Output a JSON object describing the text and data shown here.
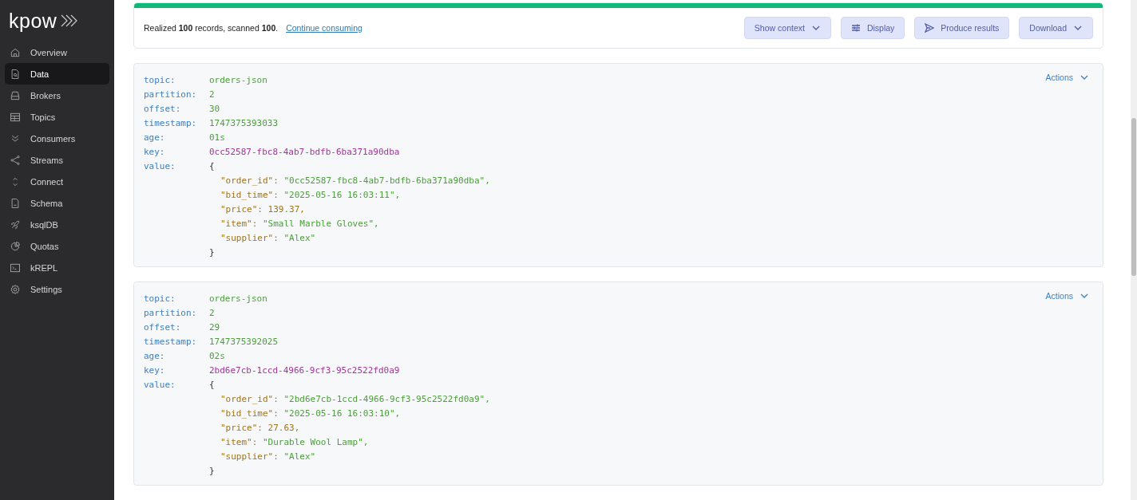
{
  "sidebar": {
    "logo": "kpow",
    "items": [
      {
        "label": "Overview",
        "selected": false
      },
      {
        "label": "Data",
        "selected": true
      },
      {
        "label": "Brokers",
        "selected": false
      },
      {
        "label": "Topics",
        "selected": false
      },
      {
        "label": "Consumers",
        "selected": false
      },
      {
        "label": "Streams",
        "selected": false
      },
      {
        "label": "Connect",
        "selected": false
      },
      {
        "label": "Schema",
        "selected": false
      },
      {
        "label": "ksqlDB",
        "selected": false
      },
      {
        "label": "Quotas",
        "selected": false
      },
      {
        "label": "kREPL",
        "selected": false
      },
      {
        "label": "Settings",
        "selected": false
      }
    ]
  },
  "progress": {
    "level": 1
  },
  "summary": {
    "text": "Realized **100** records, scanned **100**.",
    "link": "Continue consuming"
  },
  "toolbar": [
    {
      "label": "Show context",
      "kind": "dropdown"
    },
    {
      "label": "Display",
      "kind": "sliders"
    },
    {
      "label": "Produce results",
      "kind": "send"
    },
    {
      "label": "Download",
      "kind": "dropdown"
    }
  ],
  "records": [
    {
      "actions": "Actions",
      "fields": [
        {
          "label": "topic:",
          "value": "orders-json",
          "kind": "plain"
        },
        {
          "label": "partition:",
          "value": "2",
          "kind": "plain"
        },
        {
          "label": "offset:",
          "value": "30",
          "kind": "plain"
        },
        {
          "label": "timestamp:",
          "value": "1747375393033",
          "kind": "plain"
        },
        {
          "label": "age:",
          "value": "01s",
          "kind": "plain"
        },
        {
          "label": "key:",
          "value": "0cc52587-fbc8-4ab7-bdfb-6ba371a90dba",
          "kind": "key"
        }
      ],
      "value_label": "value:",
      "open": "{",
      "close": "}",
      "lines": [
        {
          "key": "\"order_id\":",
          "value": "\"0cc52587-fbc8-4ab7-bdfb-6ba371a90dba\",",
          "kind": "string"
        },
        {
          "key": "\"bid_time\":",
          "value": "\"2025-05-16 16:03:11\",",
          "kind": "string"
        },
        {
          "key": "\"price\":",
          "value": "139.37,",
          "kind": "number"
        },
        {
          "key": "\"item\":",
          "value": "\"Small Marble Gloves\",",
          "kind": "string"
        },
        {
          "key": "\"supplier\":",
          "value": "\"Alex\"",
          "kind": "string"
        }
      ]
    },
    {
      "actions": "Actions",
      "fields": [
        {
          "label": "topic:",
          "value": "orders-json",
          "kind": "plain"
        },
        {
          "label": "partition:",
          "value": "2",
          "kind": "plain"
        },
        {
          "label": "offset:",
          "value": "29",
          "kind": "plain"
        },
        {
          "label": "timestamp:",
          "value": "1747375392025",
          "kind": "plain"
        },
        {
          "label": "age:",
          "value": "02s",
          "kind": "plain"
        },
        {
          "label": "key:",
          "value": "2bd6e7cb-1ccd-4966-9cf3-95c2522fd0a9",
          "kind": "key"
        }
      ],
      "value_label": "value:",
      "open": "{",
      "close": "}",
      "lines": [
        {
          "key": "\"order_id\":",
          "value": "\"2bd6e7cb-1ccd-4966-9cf3-95c2522fd0a9\",",
          "kind": "string"
        },
        {
          "key": "\"bid_time\":",
          "value": "\"2025-05-16 16:03:10\",",
          "kind": "string"
        },
        {
          "key": "\"price\":",
          "value": "27.63,",
          "kind": "number"
        },
        {
          "key": "\"item\":",
          "value": "\"Durable Wool Lamp\",",
          "kind": "string"
        },
        {
          "key": "\"supplier\":",
          "value": "\"Alex\"",
          "kind": "string"
        }
      ]
    }
  ]
}
